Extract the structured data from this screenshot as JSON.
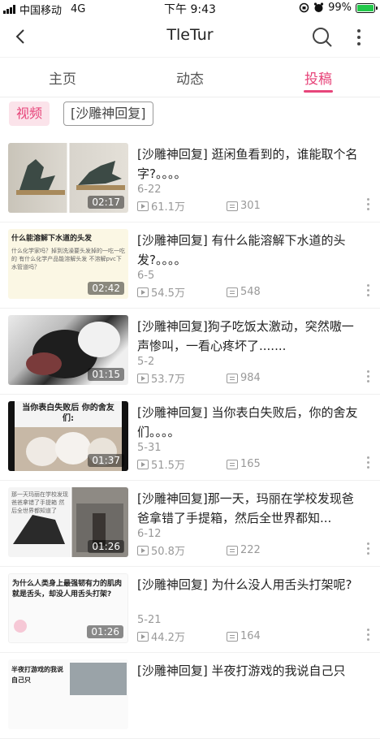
{
  "status_bar": {
    "carrier": "中国移动",
    "network": "4G",
    "time": "下午 9:43",
    "battery": "99%",
    "battery_level": 0.99
  },
  "header": {
    "title": "TleTur",
    "back_icon": "chevron-left-icon",
    "search_icon": "search-icon",
    "more_icon": "more-vertical-icon"
  },
  "tabs": [
    {
      "label": "主页",
      "active": false
    },
    {
      "label": "动态",
      "active": false
    },
    {
      "label": "投稿",
      "active": true
    }
  ],
  "filters": {
    "type": "视频",
    "tag": "[沙雕神回复]"
  },
  "accent_color": "#e7457a",
  "videos": [
    {
      "title": "[沙雕神回复] 逛闲鱼看到的，谁能取个名字?。。。。",
      "date": "6-22",
      "views": "61.1万",
      "comments": "301",
      "duration": "02:17"
    },
    {
      "title": "[沙雕神回复] 有什么能溶解下水道的头发?。。。。",
      "date": "6-5",
      "views": "54.5万",
      "comments": "548",
      "duration": "02:42",
      "thumb_text": "什么能溶解下水道的头发",
      "thumb_sub": "什么化学家吗？掉到洗澡要头发掉的一吃一吃的 有什么化学产品能溶解头发 不溶解pvc下水管道吗？"
    },
    {
      "title": "[沙雕神回复]狗子吃饭太激动，突然嗷一声惨叫，一看心疼坏了.......",
      "date": "5-2",
      "views": "53.7万",
      "comments": "984",
      "duration": "01:15"
    },
    {
      "title": "[沙雕神回复] 当你表白失败后，你的舍友们。。。。",
      "date": "5-31",
      "views": "51.5万",
      "comments": "165",
      "duration": "01:37",
      "thumb_text": "当你表白失败后 你的舍友们:"
    },
    {
      "title": "[沙雕神回复]那一天，玛丽在学校发现爸爸拿错了手提箱，然后全世界都知...",
      "date": "6-12",
      "views": "50.8万",
      "comments": "222",
      "duration": "01:26",
      "thumb_text": "那一天玛丽在学校发现爸爸拿错了手提箱 然后全世界都知道了"
    },
    {
      "title": "[沙雕神回复] 为什么没人用舌头打架呢?",
      "date": "5-21",
      "views": "44.2万",
      "comments": "164",
      "duration": "01:26",
      "thumb_text": "为什么人类身上最强韧有力的肌肉就是舌头，却没人用舌头打架?"
    },
    {
      "title": "[沙雕神回复] 半夜打游戏的我说自己只",
      "date": "",
      "views": "",
      "comments": "",
      "duration": "",
      "thumb_text": "半夜打游戏的我说自己只"
    }
  ]
}
